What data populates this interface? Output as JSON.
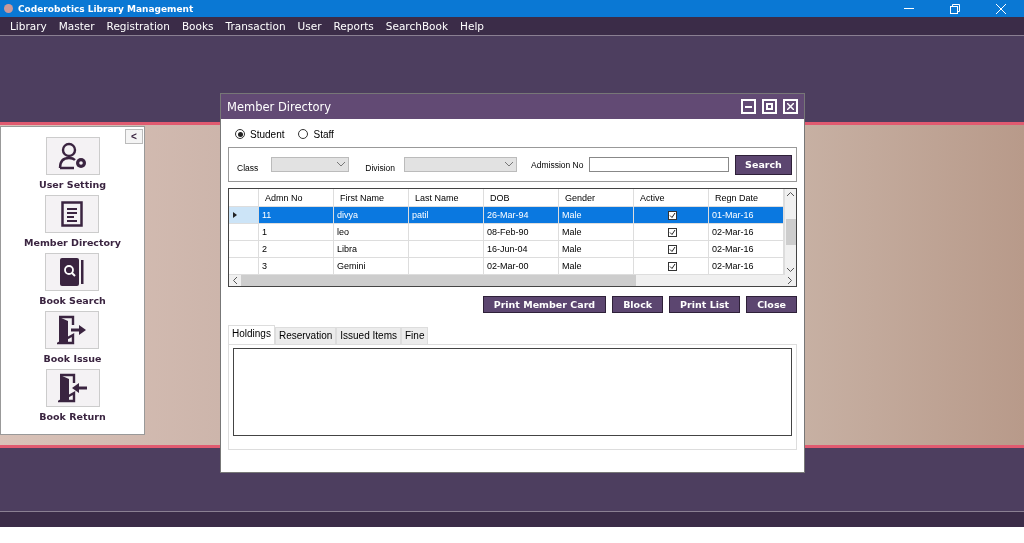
{
  "app_window": {
    "title": "Coderobotics Library Management"
  },
  "menu": [
    "Library",
    "Master",
    "Registration",
    "Books",
    "Transaction",
    "User",
    "Reports",
    "SearchBook",
    "Help"
  ],
  "sidebar": {
    "collapse_button": "<",
    "items": [
      {
        "label": "User Setting",
        "kind": "user-gear"
      },
      {
        "label": "Member Directory",
        "kind": "document"
      },
      {
        "label": "Book Search",
        "kind": "book-search"
      },
      {
        "label": "Book Issue",
        "kind": "door-out"
      },
      {
        "label": "Book Return",
        "kind": "door-in"
      }
    ]
  },
  "dialog": {
    "title": "Member Directory",
    "member_type": [
      {
        "label": "Student",
        "selected": true
      },
      {
        "label": "Staff",
        "selected": false
      }
    ],
    "filters": {
      "class_label": "Class",
      "division_label": "Division",
      "admission_label": "Admission No",
      "search_button": "Search"
    },
    "table": {
      "columns": [
        "Admn No",
        "First Name",
        "Last Name",
        "DOB",
        "Gender",
        "Active",
        "Regn Date"
      ],
      "rows": [
        {
          "cells": [
            "11",
            "divya",
            "patil",
            "26-Mar-94",
            "Male"
          ],
          "active": true,
          "regn_date": "01-Mar-16",
          "selected": true
        },
        {
          "cells": [
            "1",
            "leo",
            "",
            "08-Feb-90",
            "Male"
          ],
          "active": true,
          "regn_date": "02-Mar-16",
          "selected": false
        },
        {
          "cells": [
            "2",
            "Libra",
            "",
            "16-Jun-04",
            "Male"
          ],
          "active": true,
          "regn_date": "02-Mar-16",
          "selected": false
        },
        {
          "cells": [
            "3",
            "Gemini",
            "",
            "02-Mar-00",
            "Male"
          ],
          "active": true,
          "regn_date": "02-Mar-16",
          "selected": false
        }
      ]
    },
    "buttons": [
      "Print Member Card",
      "Block",
      "Print List",
      "Close"
    ],
    "tabs": [
      {
        "label": "Holdings",
        "selected": true
      },
      {
        "label": "Reservation",
        "selected": false
      },
      {
        "label": "Issued Items",
        "selected": false
      },
      {
        "label": "Fine",
        "selected": false
      }
    ]
  }
}
